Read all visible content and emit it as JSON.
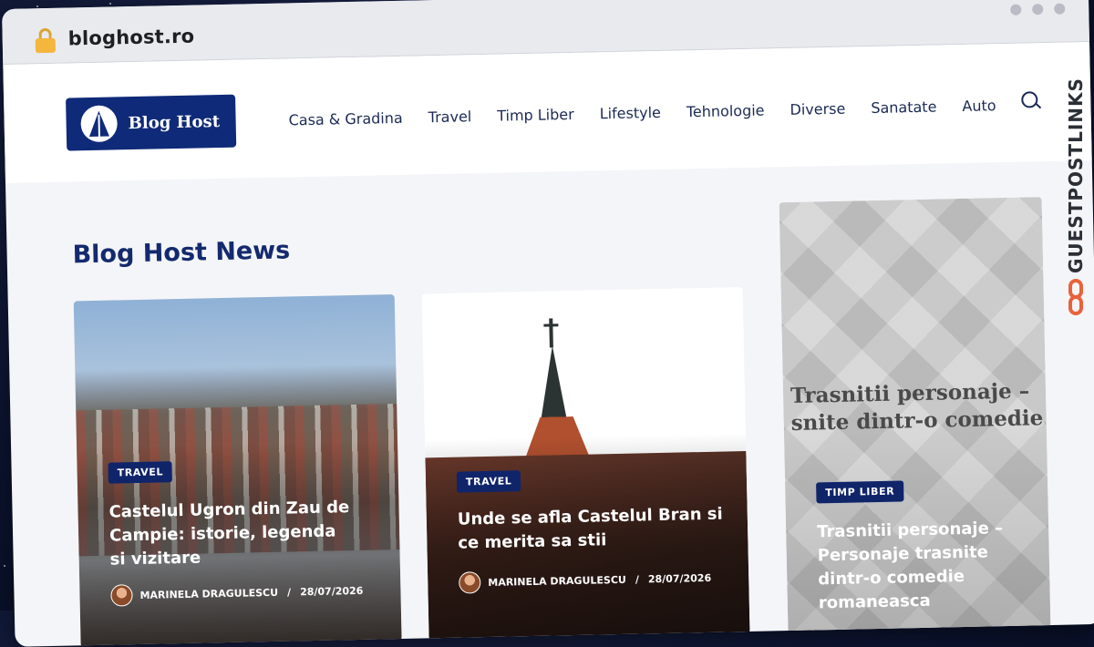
{
  "browser": {
    "url": "bloghost.ro"
  },
  "header": {
    "logo_text": "Blog Host",
    "nav": [
      "Casa & Gradina",
      "Travel",
      "Timp Liber",
      "Lifestyle",
      "Tehnologie",
      "Diverse",
      "Sanatate",
      "Auto"
    ]
  },
  "main": {
    "section_title": "Blog Host News",
    "cards": [
      {
        "category": "TRAVEL",
        "title": "Castelul Ugron din Zau de Campie: istorie, legenda si vizitare",
        "author": "MARINELA DRAGULESCU",
        "date": "28/07/2026"
      },
      {
        "category": "TRAVEL",
        "title": "Unde se afla Castelul Bran si ce merita sa stii",
        "author": "MARINELA DRAGULESCU",
        "date": "28/07/2026"
      },
      {
        "category": "TIMP LIBER",
        "title": "Trasnitii personaje – Personaje trasnite dintr-o comedie romaneasca",
        "image_text_line1": "Trasnitii personaje –",
        "image_text_line2": "snite dintr-o comedie"
      }
    ]
  },
  "watermark": {
    "text": "GUESTPOSTLINKS"
  },
  "colors": {
    "brand": "#0f2a78",
    "badge": "#10246a",
    "watermark_accent": "#e8623b"
  }
}
